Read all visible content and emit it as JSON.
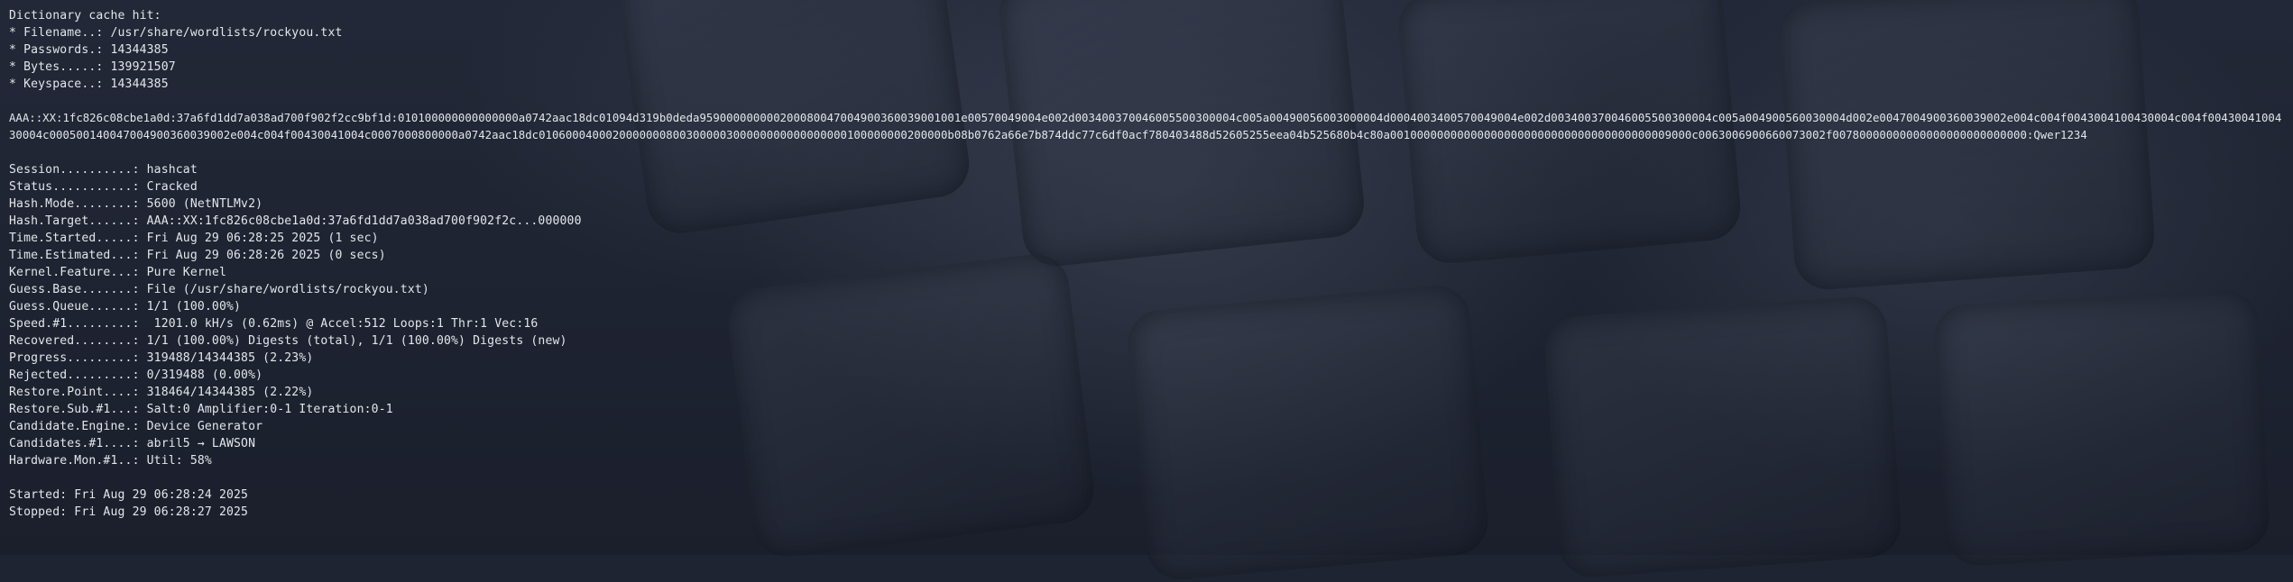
{
  "cache": {
    "header": "Dictionary cache hit:",
    "filename": "* Filename..: /usr/share/wordlists/rockyou.txt",
    "passwords": "* Passwords.: 14344385",
    "bytes": "* Bytes.....: 139921507",
    "keyspace": "* Keyspace..: 14344385"
  },
  "cracked_hash": "AAA::XX:1fc826c08cbe1a0d:37a6fd1dd7a038ad700f902f2cc9bf1d:010100000000000000a0742aac18dc01094d319b0deda959000000000200080047004900360039001001e00570049004e002d003400370046005500300004c005a00490056003000004d0004003400570049004e002d003400370046005500300004c005a004900560030004d002e0047004900360039002e004c004f0043004100430004c004f0043004100430004c000500140047004900360039002e004c004f00430041004c0007000800000a0742aac18dc0106000400020000000800300000300000000000000000100000000200000b08b0762a66e7b874ddc77c6df0acf780403488d52605255eea04b525680b4c80a001000000000000000000000000000000000000009000c0063006900660073002f00780000000000000000000000000:Qwer1234",
  "status_lines": [
    "Session..........: hashcat",
    "Status...........: Cracked",
    "Hash.Mode........: 5600 (NetNTLMv2)",
    "Hash.Target......: AAA::XX:1fc826c08cbe1a0d:37a6fd1dd7a038ad700f902f2c...000000",
    "Time.Started.....: Fri Aug 29 06:28:25 2025 (1 sec)",
    "Time.Estimated...: Fri Aug 29 06:28:26 2025 (0 secs)",
    "Kernel.Feature...: Pure Kernel",
    "Guess.Base.......: File (/usr/share/wordlists/rockyou.txt)",
    "Guess.Queue......: 1/1 (100.00%)",
    "Speed.#1.........:  1201.0 kH/s (0.62ms) @ Accel:512 Loops:1 Thr:1 Vec:16",
    "Recovered........: 1/1 (100.00%) Digests (total), 1/1 (100.00%) Digests (new)",
    "Progress.........: 319488/14344385 (2.23%)",
    "Rejected.........: 0/319488 (0.00%)",
    "Restore.Point....: 318464/14344385 (2.22%)",
    "Restore.Sub.#1...: Salt:0 Amplifier:0-1 Iteration:0-1",
    "Candidate.Engine.: Device Generator",
    "Candidates.#1....: abril5 → LAWSON",
    "Hardware.Mon.#1..: Util: 58%"
  ],
  "timing": {
    "started": "Started: Fri Aug 29 06:28:24 2025",
    "stopped": "Stopped: Fri Aug 29 06:28:27 2025"
  }
}
